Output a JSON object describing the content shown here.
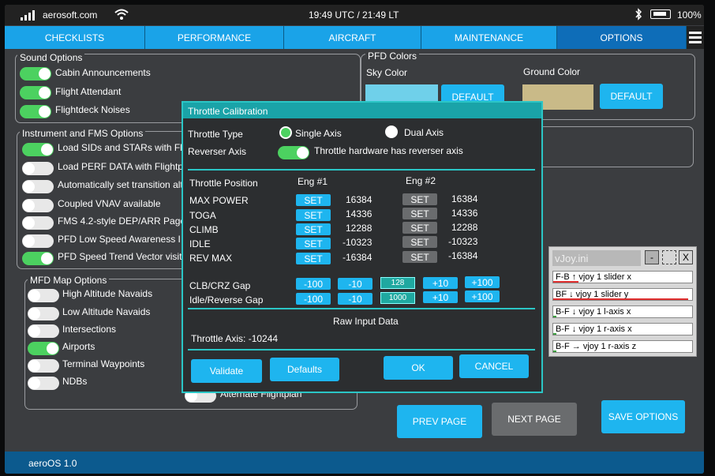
{
  "status": {
    "site": "aerosoft.com",
    "clock": "19:49 UTC / 21:49 LT",
    "battery": "100%"
  },
  "tabs": [
    {
      "label": "CHECKLISTS",
      "active": false
    },
    {
      "label": "PERFORMANCE",
      "active": false
    },
    {
      "label": "AIRCRAFT",
      "active": false
    },
    {
      "label": "MAINTENANCE",
      "active": false
    },
    {
      "label": "OPTIONS",
      "active": true
    }
  ],
  "sound": {
    "title": "Sound Options",
    "items": [
      {
        "label": "Cabin Announcements",
        "on": true
      },
      {
        "label": "Flight Attendant",
        "on": true
      },
      {
        "label": "Flightdeck Noises",
        "on": true
      }
    ]
  },
  "instrument": {
    "title": "Instrument and FMS Options",
    "items": [
      {
        "label": "Load SIDs and STARs with Fl",
        "on": true
      },
      {
        "label": "Load PERF DATA with Flightp",
        "on": false
      },
      {
        "label": "Automatically set transition alt",
        "on": false
      },
      {
        "label": "Coupled VNAV available",
        "on": false
      },
      {
        "label": "FMS 4.2-style DEP/ARR Page",
        "on": false
      },
      {
        "label": "PFD Low Speed Awareness I",
        "on": false
      },
      {
        "label": "PFD Speed Trend Vector visit",
        "on": true
      }
    ]
  },
  "mfd": {
    "title": "MFD Map Options",
    "items": [
      {
        "label": "High Altitude Navaids",
        "on": false
      },
      {
        "label": "Low Altitude Navaids",
        "on": false
      },
      {
        "label": "Intersections",
        "on": false
      },
      {
        "label": "Airports",
        "on": true
      },
      {
        "label": "Terminal Waypoints",
        "on": false
      },
      {
        "label": "NDBs",
        "on": false
      }
    ],
    "alternate": "Alternate Flightplan"
  },
  "pfd": {
    "title": "PFD Colors",
    "sky_label": "Sky Color",
    "ground_label": "Ground Color",
    "default_label": "DEFAULT",
    "sky_color": "#6fd0ea",
    "ground_color": "#c9ba88"
  },
  "nav": {
    "prev": "PREV PAGE",
    "next": "NEXT PAGE",
    "save": "SAVE OPTIONS"
  },
  "footer": {
    "version": "aeroOS 1.0"
  },
  "dialog": {
    "title": "Throttle Calibration",
    "throttle_type_label": "Throttle Type",
    "single_axis": "Single Axis",
    "dual_axis": "Dual Axis",
    "reverser_label": "Reverser Axis",
    "reverser_text": "Throttle hardware has reverser axis",
    "position_label": "Throttle Position",
    "eng1": "Eng #1",
    "eng2": "Eng #2",
    "set": "SET",
    "positions": [
      {
        "label": "MAX POWER",
        "e1": "16384",
        "e2": "16384"
      },
      {
        "label": "TOGA",
        "e1": "14336",
        "e2": "14336"
      },
      {
        "label": "CLIMB",
        "e1": "12288",
        "e2": "12288"
      },
      {
        "label": "IDLE",
        "e1": "-10323",
        "e2": "-10323"
      },
      {
        "label": "REV MAX",
        "e1": "-16384",
        "e2": "-16384"
      }
    ],
    "gaps": [
      {
        "label": "CLB/CRZ Gap",
        "value": "128"
      },
      {
        "label": "Idle/Reverse Gap",
        "value": "1000"
      }
    ],
    "steps": [
      "-100",
      "-10",
      "+10",
      "+100"
    ],
    "raw_title": "Raw Input Data",
    "raw_axis": "Throttle Axis: -10244",
    "validate": "Validate",
    "defaults": "Defaults",
    "ok": "OK",
    "cancel": "CANCEL"
  },
  "vjoy": {
    "title": "vJoy.ini",
    "rows": [
      {
        "text": "F-B ↑ vjoy 1 slider x",
        "color": "#e03030",
        "fill": 0.18
      },
      {
        "text": "BF ↓ vjoy 1 slider y",
        "color": "#e03030",
        "fill": 0.97
      },
      {
        "text": "B-F ↓ vjoy 1 l-axis x",
        "color": "#3da040",
        "fill": 0.02
      },
      {
        "text": "B-F ↓ vjoy 1 r-axis x",
        "color": "#3da040",
        "fill": 0.02
      },
      {
        "text": "B-F → vjoy 1 r-axis z",
        "color": "#3da040",
        "fill": 0.02
      }
    ]
  }
}
